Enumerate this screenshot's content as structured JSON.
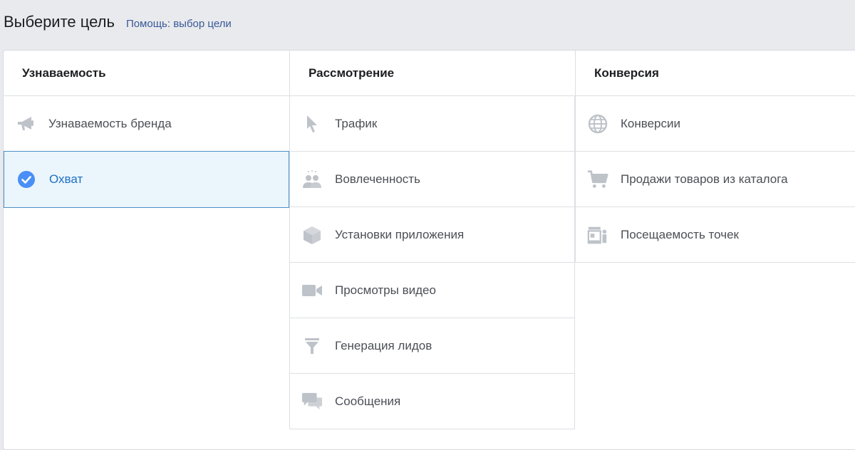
{
  "header": {
    "title": "Выберите цель",
    "help_link": "Помощь: выбор цели"
  },
  "columns": [
    {
      "heading": "Узнаваемость",
      "items": [
        {
          "label": "Узнаваемость бренда",
          "icon": "megaphone-icon",
          "selected": false
        },
        {
          "label": "Охват",
          "icon": "check-circle-icon",
          "selected": true
        }
      ]
    },
    {
      "heading": "Рассмотрение",
      "items": [
        {
          "label": "Трафик",
          "icon": "cursor-icon"
        },
        {
          "label": "Вовлеченность",
          "icon": "people-icon"
        },
        {
          "label": "Установки приложения",
          "icon": "box-icon"
        },
        {
          "label": "Просмотры видео",
          "icon": "video-camera-icon"
        },
        {
          "label": "Генерация лидов",
          "icon": "funnel-icon"
        },
        {
          "label": "Сообщения",
          "icon": "chat-bubbles-icon"
        }
      ]
    },
    {
      "heading": "Конверсия",
      "items": [
        {
          "label": "Конверсии",
          "icon": "globe-icon"
        },
        {
          "label": "Продажи товаров из каталога",
          "icon": "cart-icon"
        },
        {
          "label": "Посещаемость точек",
          "icon": "store-icon"
        }
      ]
    }
  ],
  "colors": {
    "accent": "#1e70c4",
    "selected_bg": "#ebf5fc",
    "icon_gray": "#bec3c9",
    "check_blue": "#4a8ff7"
  }
}
